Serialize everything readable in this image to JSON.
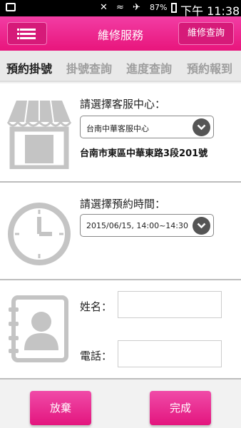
{
  "status_bar": {
    "battery": "87%",
    "time": "下午 11:38"
  },
  "header": {
    "title": "維修服務",
    "query_button": "維修查詢"
  },
  "tabs": [
    {
      "label": "預約掛號",
      "active": true
    },
    {
      "label": "掛號查詢",
      "active": false
    },
    {
      "label": "進度查詢",
      "active": false
    },
    {
      "label": "預約報到",
      "active": false
    }
  ],
  "center": {
    "label": "請選擇客服中心：",
    "selected": "台南中華客服中心",
    "address": "台南市東區中華東路3段201號"
  },
  "time": {
    "label": "請選擇預約時間：",
    "selected": "2015/06/15, 14:00~14:30"
  },
  "contact": {
    "name_label": "姓名：",
    "name_value": "",
    "phone_label": "電話：",
    "phone_value": ""
  },
  "buttons": {
    "cancel": "放棄",
    "done": "完成"
  },
  "colors": {
    "brand_pink": "#e8157c",
    "icon_gray": "#c4c4c4"
  }
}
